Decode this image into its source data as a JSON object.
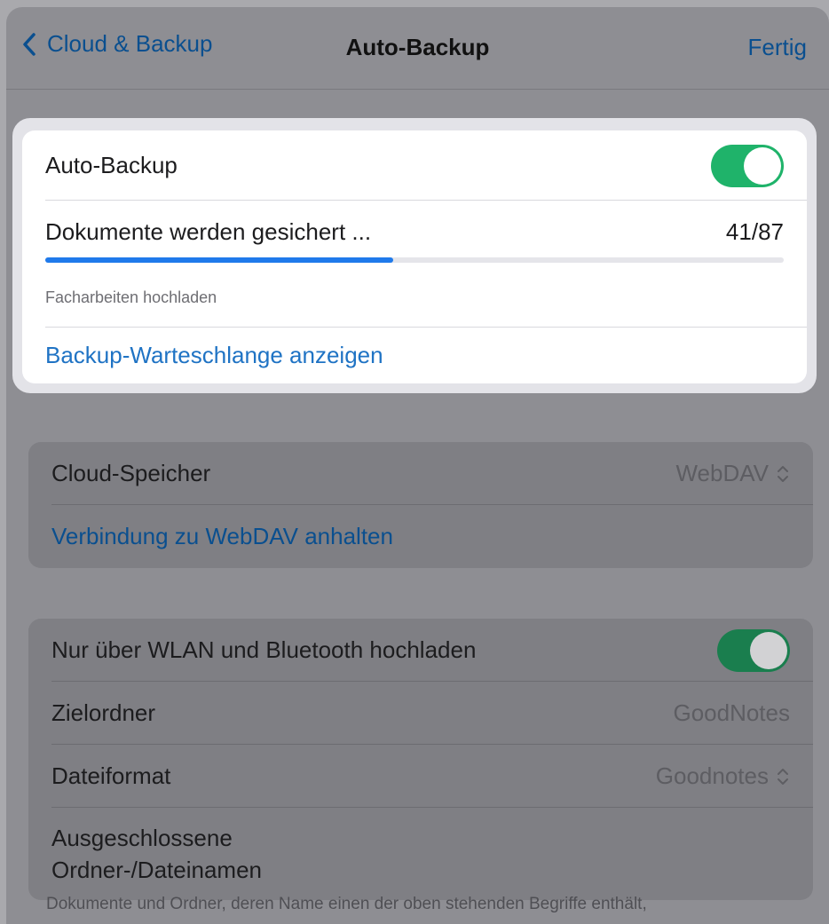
{
  "nav": {
    "back_label": "Cloud & Backup",
    "title": "Auto-Backup",
    "done_label": "Fertig"
  },
  "backup": {
    "toggle_label": "Auto-Backup",
    "toggle_on": true,
    "status_text": "Dokumente werden gesichert ...",
    "progress_count": "41/87",
    "progress_fraction": 0.471,
    "subcaption": "Facharbeiten hochladen",
    "queue_link": "Backup-Warteschlange anzeigen"
  },
  "cloud": {
    "storage_label": "Cloud-Speicher",
    "storage_value": "WebDAV",
    "disconnect_link": "Verbindung zu WebDAV anhalten"
  },
  "options": {
    "wifi_label": "Nur über WLAN und Bluetooth hochladen",
    "wifi_on": true,
    "folder_label": "Zielordner",
    "folder_value": "GoodNotes",
    "format_label": "Dateiformat",
    "format_value": "Goodnotes",
    "excluded_label_line1": "Ausgeschlossene",
    "excluded_label_line2": "Ordner-/Dateinamen"
  },
  "footer_note": "Dokumente und Ordner, deren Name einen der oben stehenden Begriffe enthält,",
  "colors": {
    "accent": "#1f73c4",
    "toggle_on": "#1fb36a",
    "progress": "#1f7aeb"
  },
  "icons": {
    "back": "chevron-left-icon",
    "popup": "chevron-up-down-icon"
  }
}
